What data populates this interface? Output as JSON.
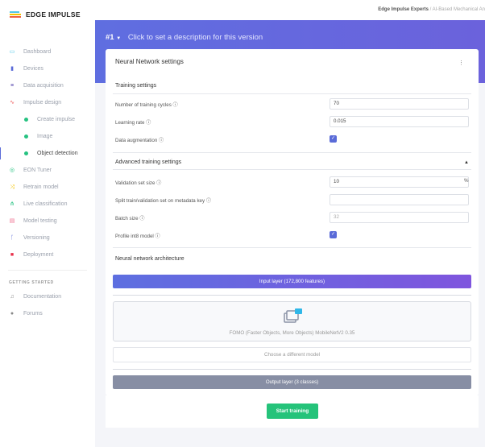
{
  "brand": "EDGE IMPULSE",
  "sidebar": {
    "items": [
      {
        "label": "Dashboard",
        "icon": "monitor-icon",
        "color": "#52c7e8"
      },
      {
        "label": "Devices",
        "icon": "device-icon",
        "color": "#5a6bd8"
      },
      {
        "label": "Data acquisition",
        "icon": "database-icon",
        "color": "#4a3aa8"
      },
      {
        "label": "Impulse design",
        "icon": "pulse-icon",
        "color": "#f06060"
      },
      {
        "label": "Create impulse",
        "sub": true
      },
      {
        "label": "Image",
        "sub": true
      },
      {
        "label": "Object detection",
        "sub": true,
        "active": true
      },
      {
        "label": "EON Tuner",
        "icon": "tuner-icon",
        "color": "#26c281"
      },
      {
        "label": "Retrain model",
        "icon": "shuffle-icon",
        "color": "#f5c400"
      },
      {
        "label": "Live classification",
        "icon": "live-icon",
        "color": "#26c281"
      },
      {
        "label": "Model testing",
        "icon": "clipboard-icon",
        "color": "#f07090"
      },
      {
        "label": "Versioning",
        "icon": "branch-icon",
        "color": "#5a6bd8"
      },
      {
        "label": "Deployment",
        "icon": "gift-icon",
        "color": "#e8304a"
      }
    ],
    "section": "GETTING STARTED",
    "extra": [
      {
        "label": "Documentation",
        "icon": "docs-icon"
      },
      {
        "label": "Forums",
        "icon": "forum-icon"
      }
    ]
  },
  "breadcrumb": {
    "org": "Edge Impulse Experts",
    "sep": "/",
    "project": "AI-Based Mechanical An"
  },
  "version": {
    "number": "#1",
    "description": "Click to set a description for this version"
  },
  "card": {
    "title": "Neural Network settings",
    "training_header": "Training settings",
    "cycles_label": "Number of training cycles ⓘ",
    "cycles": "70",
    "lr_label": "Learning rate ⓘ",
    "lr": "0.015",
    "aug_label": "Data augmentation ⓘ",
    "advanced_header": "Advanced training settings",
    "val_label": "Validation set size ⓘ",
    "val": "10",
    "val_unit": "%",
    "split_label": "Split train/validation set on metadata key ⓘ",
    "split": "",
    "batch_label": "Batch size ⓘ",
    "batch_placeholder": "32",
    "int8_label": "Profile int8 model ⓘ",
    "arch_header": "Neural network architecture",
    "input_layer": "Input layer (172,800 features)",
    "model": "FOMO (Faster Objects, More Objects) MobileNetV2 0.35",
    "choose": "Choose a different model",
    "output_layer": "Output layer (3 classes)"
  },
  "start_training": "Start training"
}
